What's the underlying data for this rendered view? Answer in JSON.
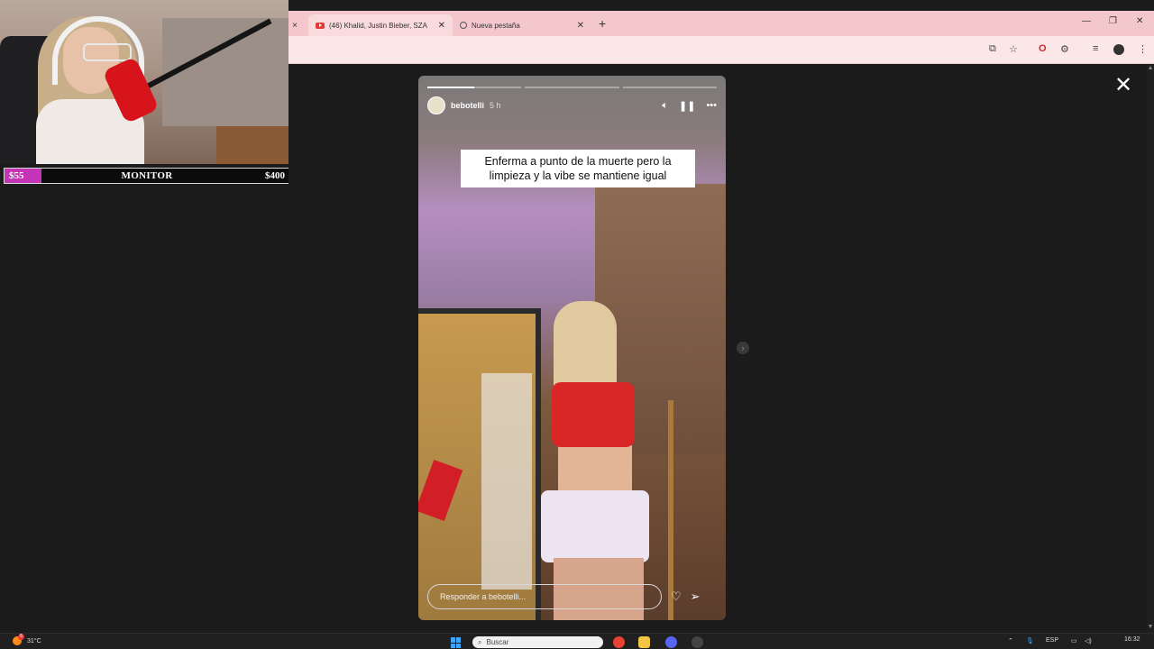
{
  "overlay": {
    "goal": {
      "start": "$55",
      "label": "MONITOR",
      "end": "$400",
      "progress": 0.13
    }
  },
  "browser": {
    "tabs": [
      {
        "title": "(46) Khalid, Justin Bieber, SZA",
        "icon": "youtube-icon"
      },
      {
        "title": "Nueva pestaña",
        "icon": "globe-icon"
      }
    ],
    "new_tab_label": "+",
    "tab_strip_close": "×",
    "window_controls": {
      "minimize": "—",
      "restore": "❐",
      "close": "✕"
    },
    "toolbar_icons": [
      "install-app-icon",
      "star-icon",
      "opera-icon",
      "extensions-icon",
      "media-icon",
      "profile-icon",
      "menu-icon"
    ]
  },
  "story": {
    "username": "bebotelli",
    "time": "5 h",
    "progress_segments": 3,
    "progress_current": 0.5,
    "caption": "Enferma a punto de la muerte pero la limpieza y la vibe se mantiene igual",
    "reply_placeholder": "Responder a bebotelli...",
    "close_label": "✕",
    "next_label": "›"
  },
  "taskbar": {
    "weather": {
      "temp": "31°C",
      "badge": "5"
    },
    "search_placeholder": "Buscar",
    "language": "ESP",
    "time": "16:32"
  },
  "colors": {
    "goal_fill": "#c334b6",
    "tab_strip": "#f4c7cd",
    "toolbar": "#fbe6e8",
    "page_bg": "#1b1b1b"
  }
}
